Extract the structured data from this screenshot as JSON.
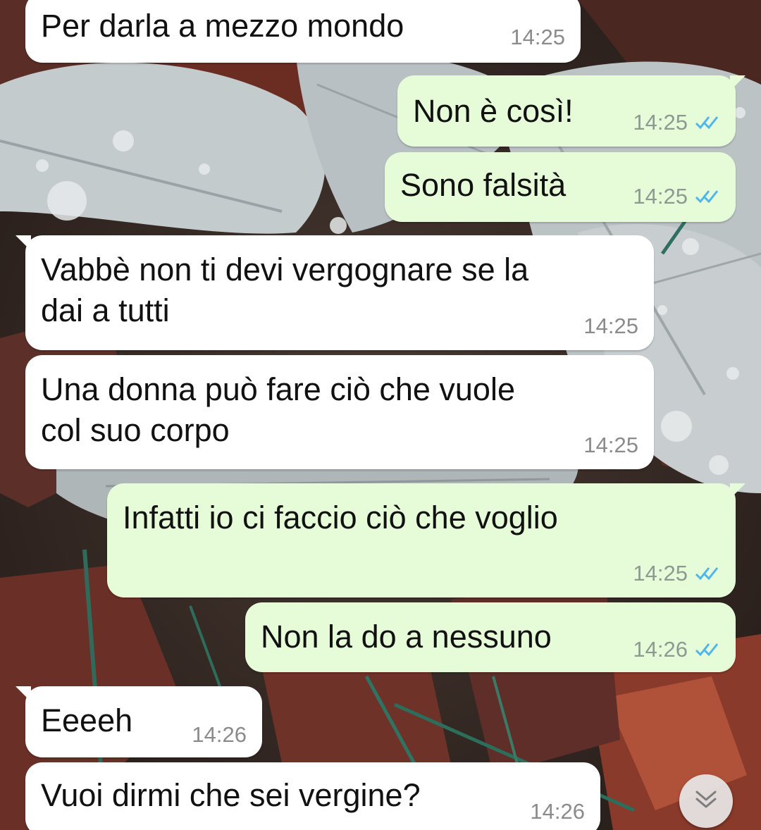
{
  "messages": [
    {
      "dir": "in",
      "text": "Per darla a mezzo mondo",
      "time": "14:25"
    },
    {
      "dir": "out",
      "text": "Non è così!",
      "time": "14:25",
      "status": "read"
    },
    {
      "dir": "out",
      "text": "Sono falsità",
      "time": "14:25",
      "status": "read"
    },
    {
      "dir": "in",
      "text": "Vabbè non ti devi vergognare se la\ndai a tutti",
      "time": "14:25"
    },
    {
      "dir": "in",
      "text": "Una donna può fare ciò che vuole\ncol suo corpo",
      "time": "14:25"
    },
    {
      "dir": "out",
      "text": "Infatti io ci faccio ciò che voglio",
      "time": "14:25",
      "status": "read"
    },
    {
      "dir": "out",
      "text": "Non la do a nessuno",
      "time": "14:26",
      "status": "read"
    },
    {
      "dir": "in",
      "text": "Eeeeh",
      "time": "14:26"
    },
    {
      "dir": "in",
      "text": "Vuoi dirmi che sei vergine?",
      "time": "14:26"
    }
  ],
  "icons": {
    "read_receipt": "double-check-icon",
    "scroll_down": "double-chevron-down-icon"
  },
  "colors": {
    "incoming_bubble": "#ffffff",
    "outgoing_bubble": "#e6fcd8",
    "read_tick": "#4fb6ec",
    "time_text": "#8d9a92"
  }
}
